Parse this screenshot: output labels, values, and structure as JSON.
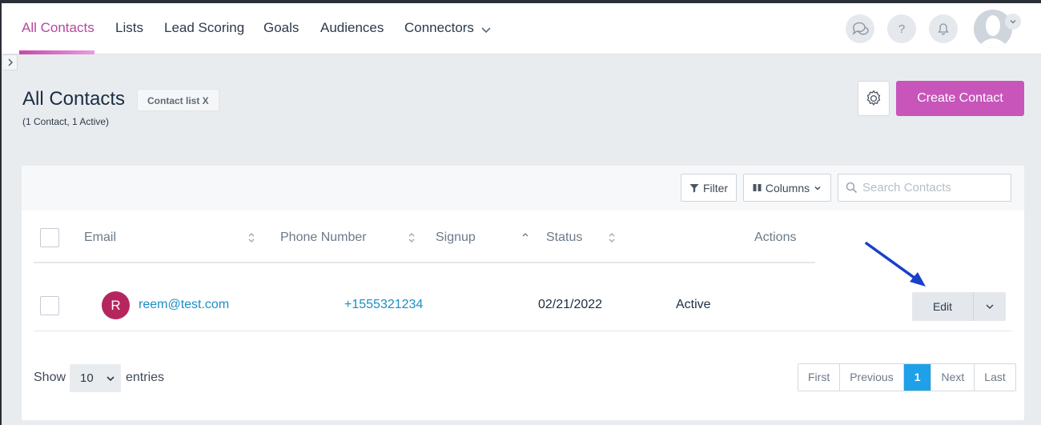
{
  "nav": {
    "items": [
      {
        "label": "All Contacts",
        "active": true
      },
      {
        "label": "Lists"
      },
      {
        "label": "Lead Scoring"
      },
      {
        "label": "Goals"
      },
      {
        "label": "Audiences"
      },
      {
        "label": "Connectors"
      }
    ],
    "icons": [
      "chat-icon",
      "help-icon",
      "bell-icon",
      "user-avatar"
    ]
  },
  "page": {
    "title": "All Contacts",
    "tag": "Contact list X",
    "subtitle": "(1 Contact, 1 Active)",
    "create_label": "Create Contact"
  },
  "toolbar": {
    "filter_label": "Filter",
    "columns_label": "Columns",
    "search_placeholder": "Search Contacts",
    "search_value": ""
  },
  "table": {
    "headers": {
      "email": "Email",
      "phone": "Phone Number",
      "signup": "Signup",
      "status": "Status",
      "actions": "Actions"
    },
    "rows": [
      {
        "initial": "R",
        "email": "reem@test.com",
        "phone": "+1555321234",
        "signup": "02/21/2022",
        "status": "Active",
        "action_label": "Edit"
      }
    ]
  },
  "footer": {
    "show_label": "Show",
    "page_size": "10",
    "entries_label": "entries",
    "pagination": {
      "first": "First",
      "previous": "Previous",
      "current": "1",
      "next": "Next",
      "last": "Last"
    }
  },
  "colors": {
    "brand": "#c755ba",
    "nav_active": "#b6479d",
    "link": "#1a8fc4",
    "pagination_active": "#1ea1e8",
    "avatar": "#b5265f",
    "annotation_arrow": "#1a3fc8"
  }
}
